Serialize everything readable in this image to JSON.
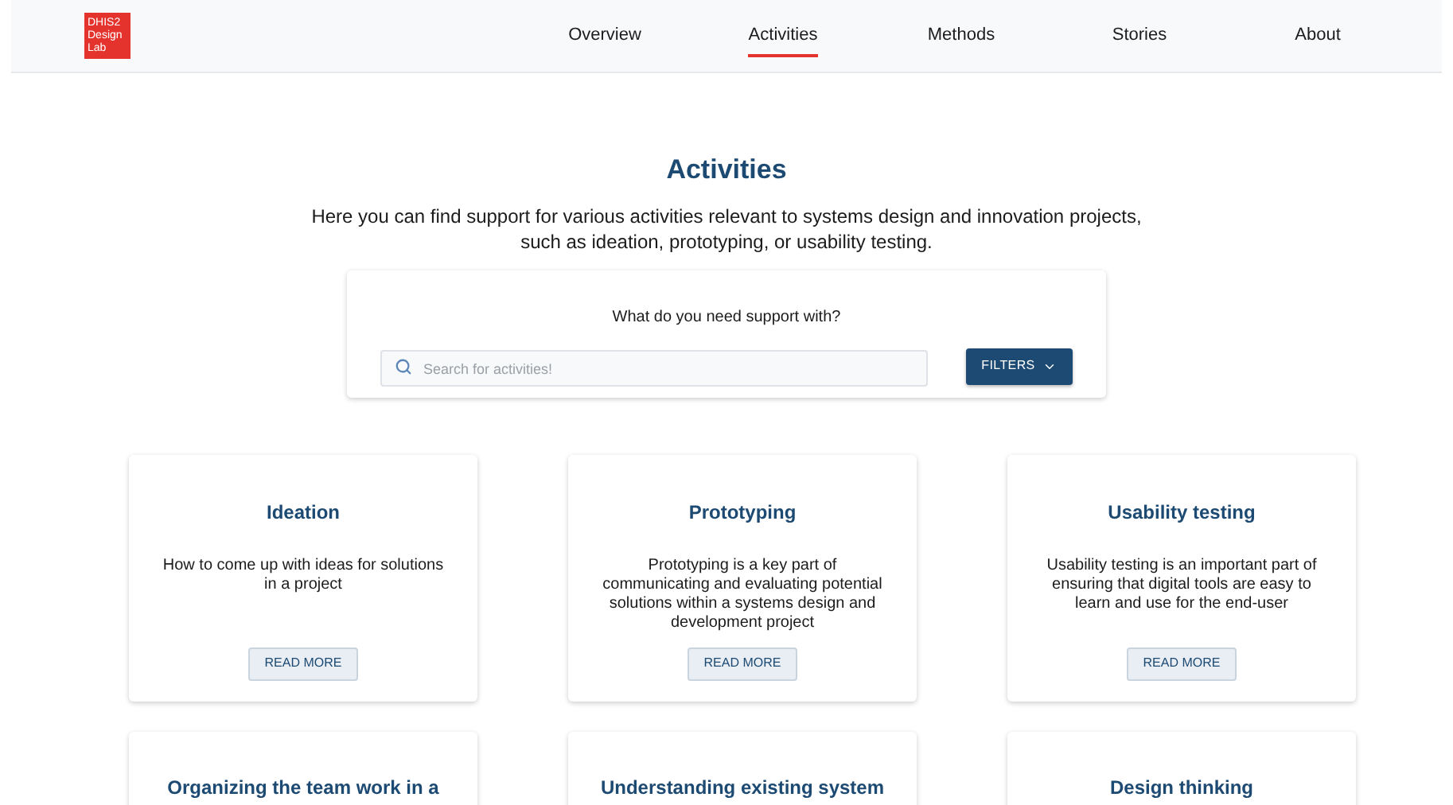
{
  "logo": "DHIS2 Design Lab",
  "nav": [
    {
      "label": "Overview",
      "selected": false
    },
    {
      "label": "Activities",
      "selected": true
    },
    {
      "label": "Methods",
      "selected": false
    },
    {
      "label": "Stories",
      "selected": false
    },
    {
      "label": "About",
      "selected": false
    }
  ],
  "heading": "Activities",
  "intro": "Here you can find support for various activities relevant to systems design and innovation projects, such as ideation, prototyping, or usability testing.",
  "search_panel": {
    "prompt": "What do you need support with?",
    "placeholder": "Search for activities!",
    "filters_button": "FILTERS"
  },
  "cards": [
    {
      "title": "Ideation",
      "description": "How to come up with ideas for solutions in a project",
      "button": "READ MORE"
    },
    {
      "title": "Prototyping",
      "description": "Prototyping is a key part of communicating and evaluating potential solutions within a systems design and development project",
      "button": "READ MORE"
    },
    {
      "title": "Usability testing",
      "description": "Usability testing is an important part of ensuring that digital tools are easy to learn and use for the end-user",
      "button": "READ MORE"
    },
    {
      "title": "Organizing the team work in a"
    },
    {
      "title": "Understanding existing system"
    },
    {
      "title": "Design thinking"
    }
  ]
}
